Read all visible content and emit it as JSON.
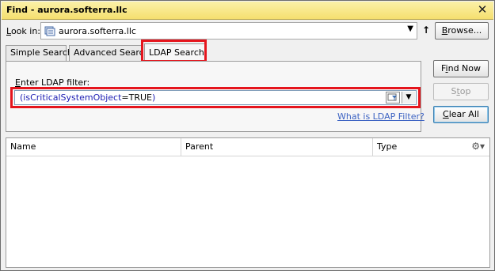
{
  "window": {
    "title": "Find - aurora.softerra.llc",
    "close_glyph": "✕"
  },
  "lookin": {
    "label": "Look in:",
    "value": "aurora.softerra.llc",
    "dropdown_glyph": "▼",
    "up_glyph": "↑",
    "browse_label": "Browse..."
  },
  "tabs": [
    {
      "label": "Simple Search",
      "active": false
    },
    {
      "label": "Advanced Search",
      "active": false
    },
    {
      "label": "LDAP Search",
      "active": true
    }
  ],
  "ldap": {
    "label": "Enter LDAP filter:",
    "filter_paren_open": "(",
    "filter_attr": "isCriticalSystemObject",
    "filter_eq": "=",
    "filter_value": "TRUE",
    "filter_paren_close": ")",
    "dropdown_glyph": "▼",
    "help_link": "What is LDAP Filter?"
  },
  "actions": {
    "find_now": "Find Now",
    "stop": "Stop",
    "clear_all": "Clear All"
  },
  "results": {
    "columns": [
      "Name",
      "Parent",
      "Type"
    ],
    "gear_glyph": "⚙▾",
    "rows": []
  },
  "colors": {
    "highlight": "#e5151d",
    "titlebar": "#f5df6f",
    "link": "#3b62c2"
  }
}
